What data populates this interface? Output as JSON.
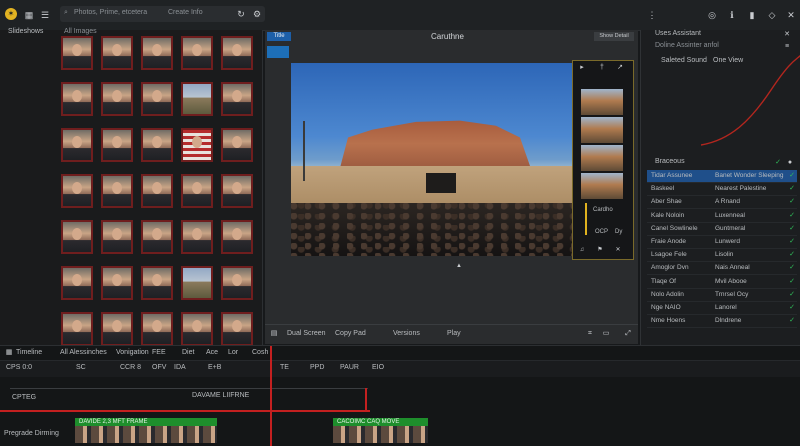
{
  "topbar": {
    "app_logo": "app-logo",
    "search_placeholder": "Photos, Prime, etcetera",
    "search_hint": "Create Info",
    "icons": [
      "grid-icon",
      "list-icon",
      "refresh-icon",
      "settings-icon",
      "search-icon",
      "dots-icon",
      "globe-icon",
      "diamond-icon",
      "close-icon"
    ]
  },
  "left": {
    "title": "Slideshows",
    "subtitle": "All Images",
    "thumbs": [
      "face",
      "face",
      "face",
      "face",
      "face",
      "face",
      "face",
      "face",
      "land",
      "face",
      "face",
      "face",
      "face",
      "flag",
      "face",
      "face",
      "face",
      "face",
      "face",
      "face",
      "face",
      "face",
      "face",
      "face",
      "face",
      "face",
      "face",
      "face",
      "land",
      "face",
      "face",
      "face",
      "face",
      "face",
      "face"
    ]
  },
  "viewer": {
    "badge": "Title",
    "title": "Caruthne",
    "btn": "Show Detail",
    "film_labels": [
      "Cardho",
      "OCP",
      "Dy"
    ],
    "bottom": [
      "Dual Screen",
      "Copy Pad",
      "Versions",
      "Play"
    ]
  },
  "right": {
    "header": "Uses Assistant",
    "sub1": "Doline Assinter anfol",
    "info_name": "Saleted Sound",
    "info_val": "One View",
    "section": "Braceous",
    "rows": [
      {
        "k": "Tidar Assunee",
        "v": "Banet Wonder Sleeping"
      },
      {
        "k": "Baskeel",
        "v": "Nearest Palestine"
      },
      {
        "k": "Aber Shae",
        "v": "A Rnand"
      },
      {
        "k": "Kale Noloin",
        "v": "Luxenneal"
      },
      {
        "k": "Canel Sowlinele",
        "v": "Guntmeral"
      },
      {
        "k": "Fraie Anode",
        "v": "Lunwerd"
      },
      {
        "k": "Lsagoe Fele",
        "v": "Lisolin"
      },
      {
        "k": "Amoglor Dvn",
        "v": "Nais Anneal"
      },
      {
        "k": "Tlaqe Of",
        "v": "Mvil Abooe"
      },
      {
        "k": "Nolo Adolin",
        "v": "Trnrsel Ocy"
      },
      {
        "k": "Nge NAIO",
        "v": "Lanorel"
      },
      {
        "k": "Nme Hoens",
        "v": "Dlndrene"
      }
    ]
  },
  "timeline": {
    "toolbar": [
      "Timeline",
      "All Alessinches",
      "Vonigation",
      "FEE",
      "Diet",
      "Ace",
      "Lor",
      "Cosh"
    ],
    "ruler": [
      "CPS 0:0",
      "SC",
      "CCR 8",
      "OFV",
      "IDA",
      "E+B",
      "TE",
      "PPD",
      "PAUR",
      "EIO"
    ],
    "track_label": "Pregrade Dirming",
    "track_a": "CPTEG",
    "track_b": "DAVAME LIIFRNE",
    "clip1": "DAVIDE 2,3 MFT FRAME",
    "clip2": "CACOIMC CAQ MOVE"
  }
}
